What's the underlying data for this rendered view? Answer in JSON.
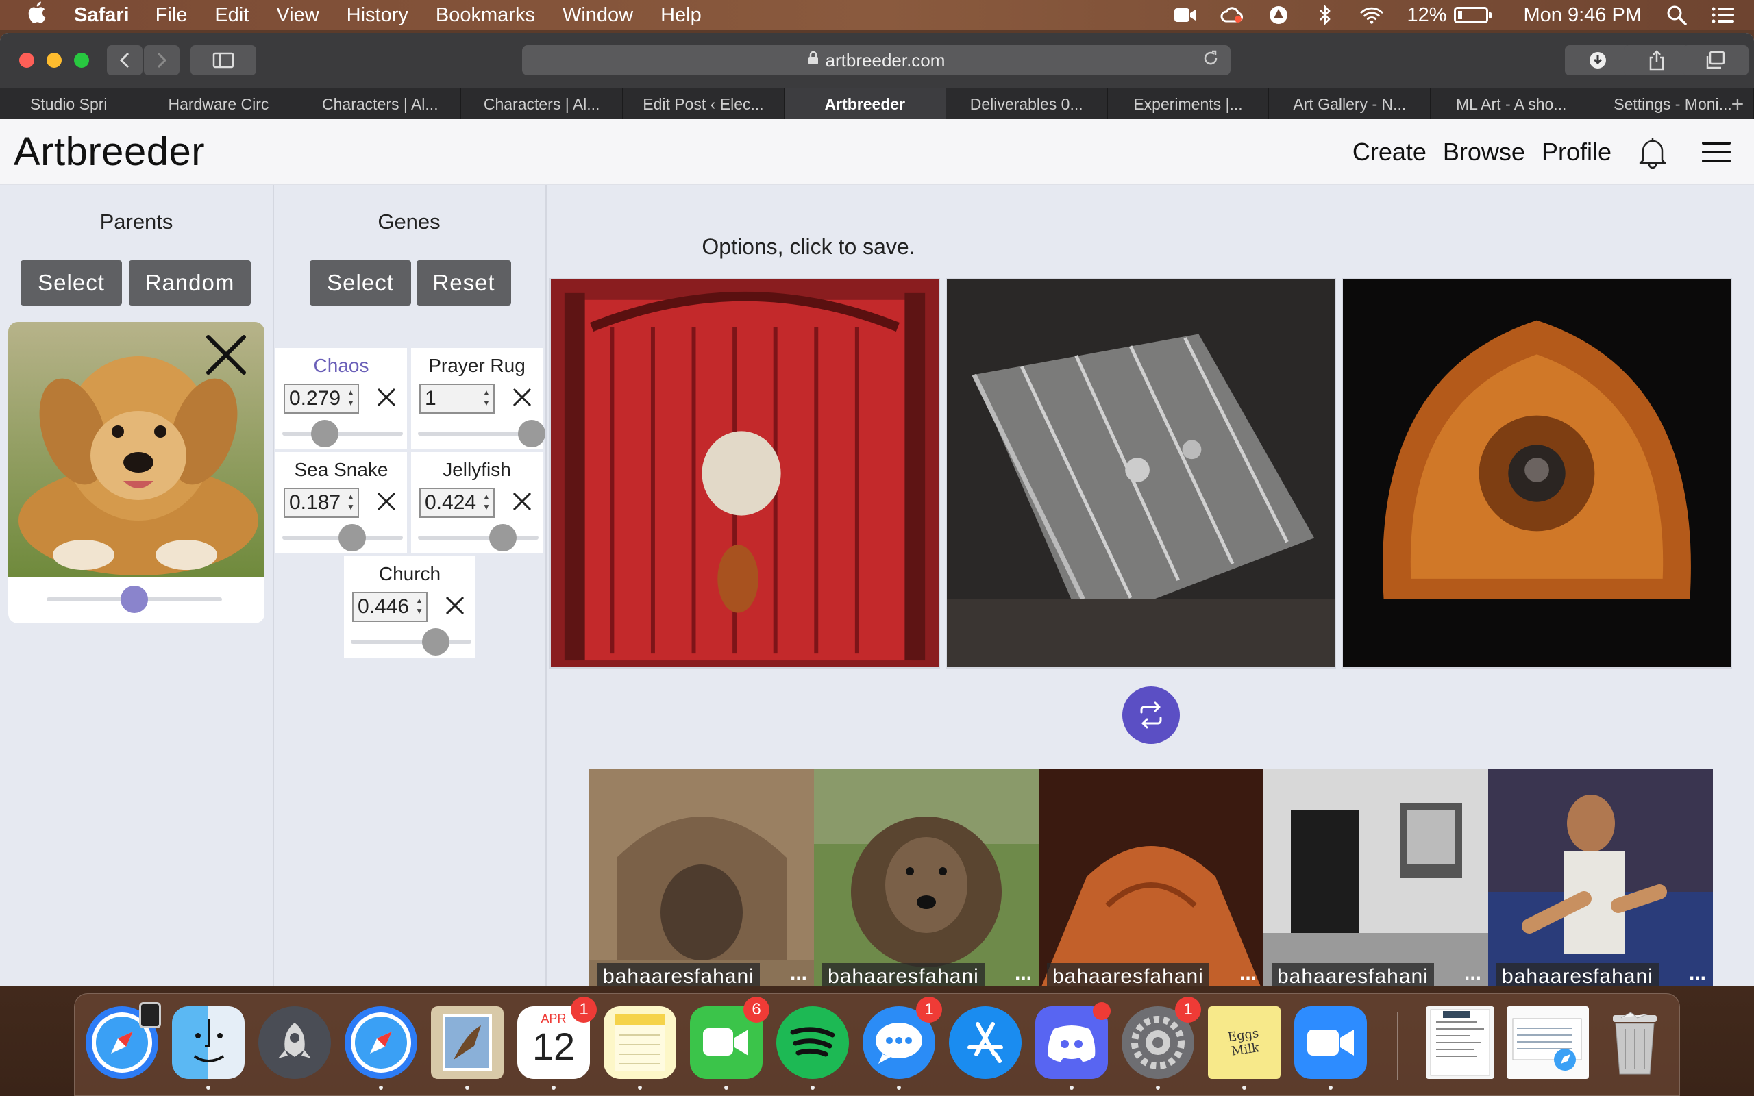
{
  "menubar": {
    "app_name": "Safari",
    "items": [
      "File",
      "Edit",
      "View",
      "History",
      "Bookmarks",
      "Window",
      "Help"
    ],
    "battery": "12%",
    "clock": "Mon 9:46 PM"
  },
  "browser": {
    "url": "artbreeder.com",
    "tabs": [
      {
        "label": "Studio Spri"
      },
      {
        "label": "Hardware Circ"
      },
      {
        "label": "Characters | Al..."
      },
      {
        "label": "Characters | Al..."
      },
      {
        "label": "Edit Post ‹ Elec..."
      },
      {
        "label": "Artbreeder",
        "active": true
      },
      {
        "label": "Deliverables 0..."
      },
      {
        "label": "Experiments |..."
      },
      {
        "label": "Art Gallery - N..."
      },
      {
        "label": "ML Art - A sho..."
      },
      {
        "label": "Settings - Moni..."
      }
    ],
    "new_tab_label": "+"
  },
  "site": {
    "logo": "Artbreeder",
    "nav": {
      "create": "Create",
      "browse": "Browse",
      "profile": "Profile"
    }
  },
  "parents": {
    "title": "Parents",
    "select_label": "Select",
    "random_label": "Random",
    "weight": 0.5
  },
  "genes": {
    "title": "Genes",
    "select_label": "Select",
    "reset_label": "Reset",
    "items": [
      {
        "name": "Chaos",
        "value": "0.279",
        "level": 0.3
      },
      {
        "name": "Prayer Rug",
        "value": "1",
        "level": 0.92
      },
      {
        "name": "Sea Snake",
        "value": "0.187",
        "level": 0.55
      },
      {
        "name": "Jellyfish",
        "value": "0.424",
        "level": 0.68
      },
      {
        "name": "Church",
        "value": "0.446",
        "level": 0.68
      }
    ]
  },
  "options": {
    "title": "Options, click to save.",
    "images": [
      "red-rug-option",
      "grey-machine-option",
      "orange-creature-option"
    ]
  },
  "gallery": {
    "items": [
      {
        "author": "bahaaresfahani",
        "more": "..."
      },
      {
        "author": "bahaaresfahani",
        "more": "..."
      },
      {
        "author": "bahaaresfahani",
        "more": "..."
      },
      {
        "author": "bahaaresfahani",
        "more": "..."
      },
      {
        "author": "bahaaresfahani",
        "more": "..."
      }
    ]
  },
  "dock": {
    "calendar_month": "APR",
    "calendar_day": "12",
    "badges": {
      "calendar": "1",
      "facetime": "6",
      "messages": "1",
      "settings": "1"
    },
    "stickies_text": "Eggs Milk"
  },
  "colors": {
    "accent": "#5b4fc4",
    "button": "#5f6063",
    "background": "#e6e9f1"
  }
}
